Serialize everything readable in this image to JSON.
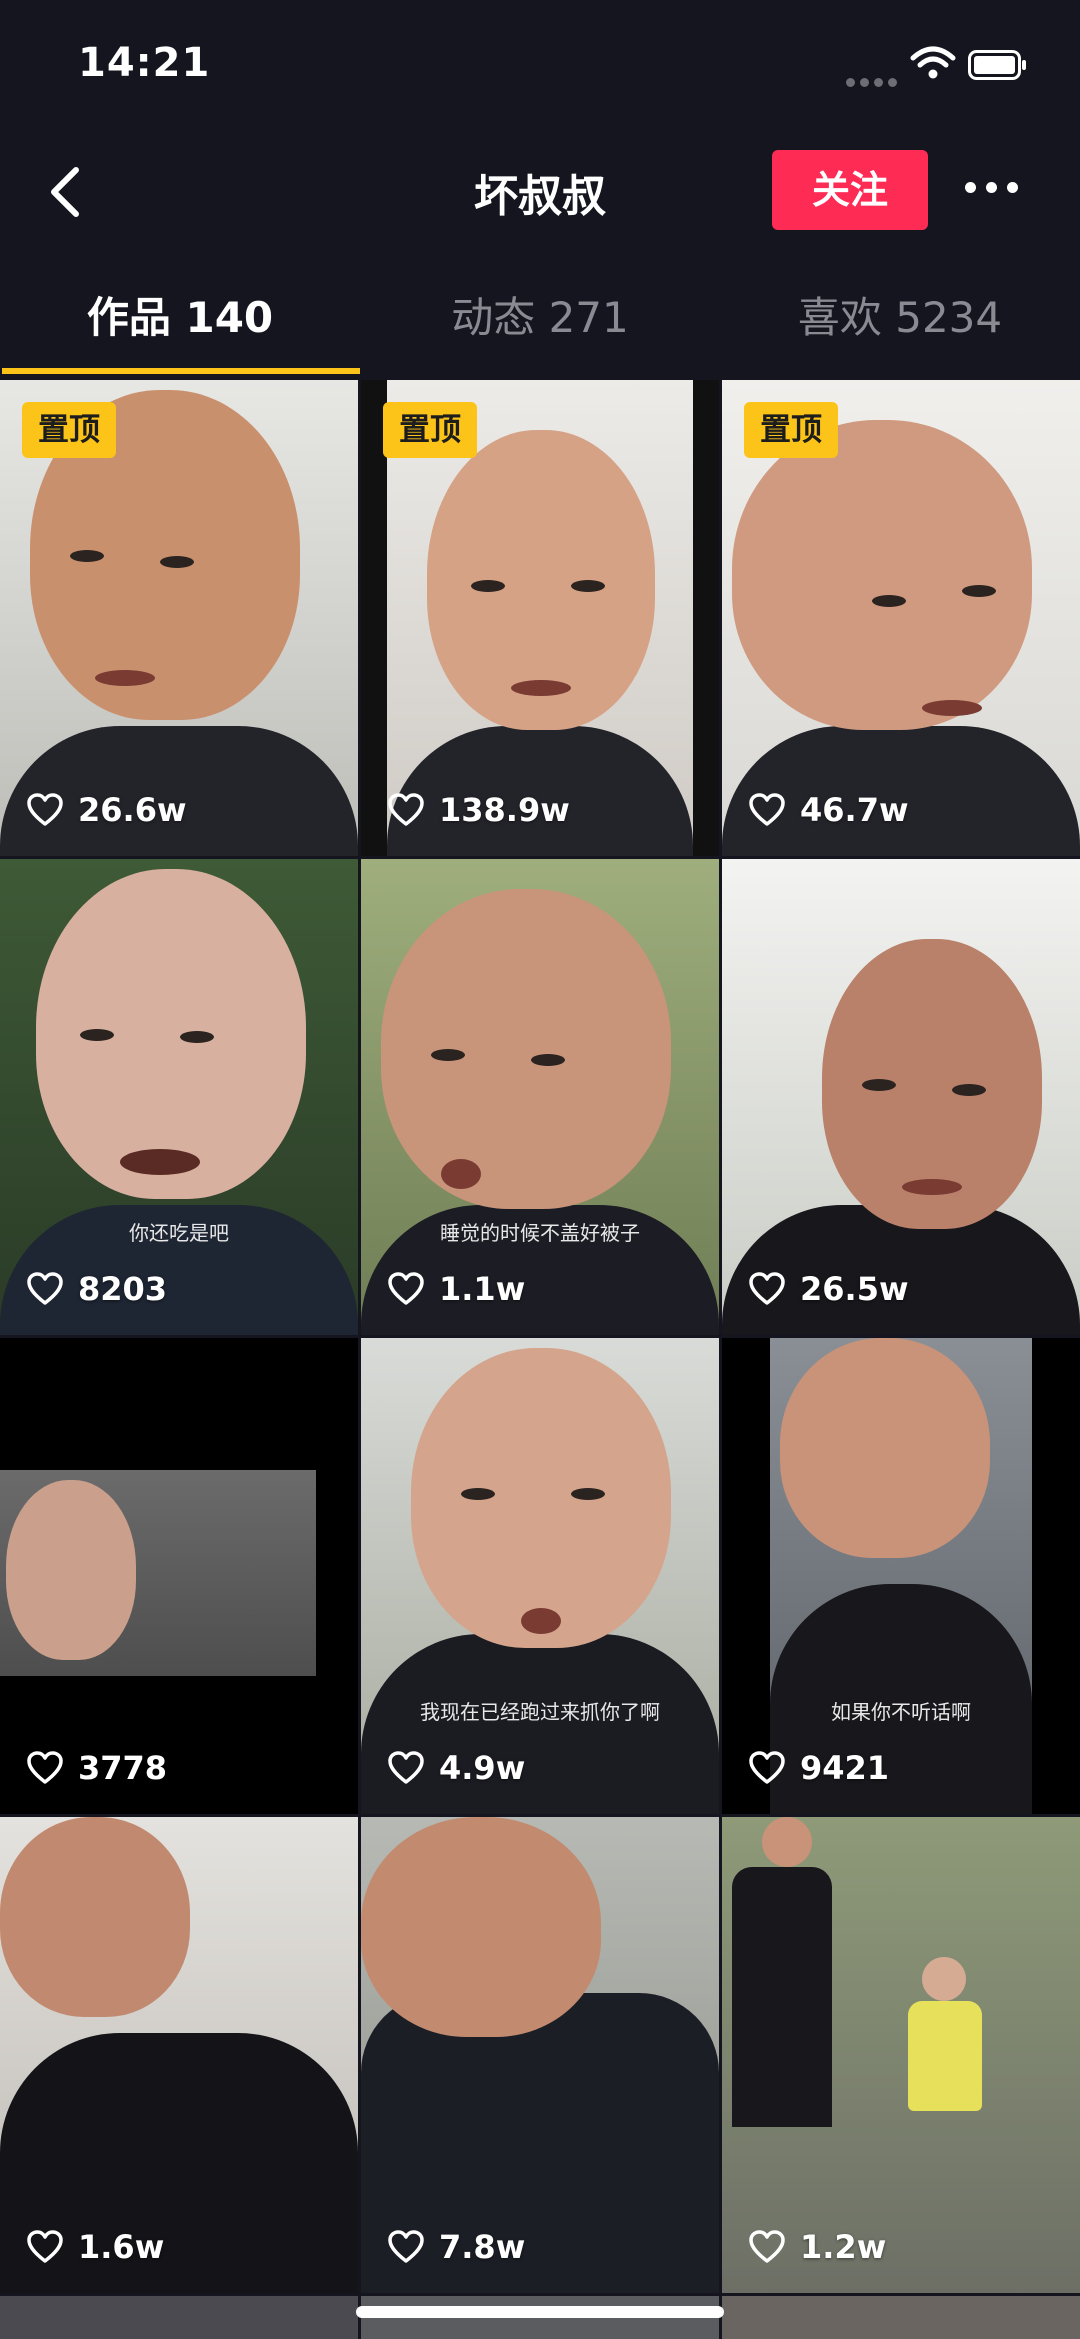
{
  "status_bar": {
    "time": "14:21"
  },
  "header": {
    "title": "坏叔叔",
    "follow_label": "关注"
  },
  "tabs": [
    {
      "label": "作品 140",
      "active": true
    },
    {
      "label": "动态 271",
      "active": false
    },
    {
      "label": "喜欢 5234",
      "active": false
    }
  ],
  "videos": [
    {
      "pinned": "置顶",
      "likes": "26.6w",
      "caption": ""
    },
    {
      "pinned": "置顶",
      "likes": "138.9w",
      "caption": ""
    },
    {
      "pinned": "置顶",
      "likes": "46.7w",
      "caption": ""
    },
    {
      "pinned": "",
      "likes": "8203",
      "caption": "你还吃是吧"
    },
    {
      "pinned": "",
      "likes": "1.1w",
      "caption": "睡觉的时候不盖好被子"
    },
    {
      "pinned": "",
      "likes": "26.5w",
      "caption": ""
    },
    {
      "pinned": "",
      "likes": "3778",
      "caption": ""
    },
    {
      "pinned": "",
      "likes": "4.9w",
      "caption": "我现在已经跑过来抓你了啊"
    },
    {
      "pinned": "",
      "likes": "9421",
      "caption": "如果你不听话啊"
    },
    {
      "pinned": "",
      "likes": "1.6w",
      "caption": ""
    },
    {
      "pinned": "",
      "likes": "7.8w",
      "caption": ""
    },
    {
      "pinned": "",
      "likes": "1.2w",
      "caption": ""
    }
  ],
  "icons": {
    "back": "chevron-left-icon",
    "more": "more-dots-icon",
    "like": "heart-outline-icon",
    "wifi": "wifi-icon",
    "battery": "battery-icon",
    "signal": "signal-icon"
  },
  "colors": {
    "accent_follow": "#fe2c55",
    "accent_tab": "#fcc419",
    "background": "#15151f"
  }
}
